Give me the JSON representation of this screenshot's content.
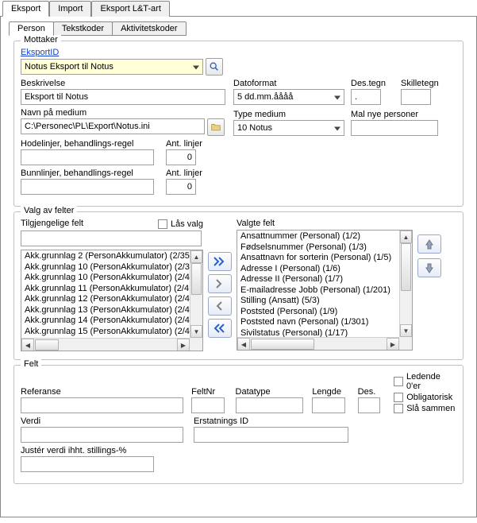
{
  "outer_tabs": {
    "t0": "Eksport",
    "t1": "Import",
    "t2": "Eksport L&T-art"
  },
  "inner_tabs": {
    "t0": "Person",
    "t1": "Tekstkoder",
    "t2": "Aktivitetskoder"
  },
  "mottaker": {
    "group": "Mottaker",
    "eksportid_label": "EksportID",
    "eksportid_value": "Notus Eksport til Notus",
    "beskrivelse_label": "Beskrivelse",
    "beskrivelse_value": "Eksport til Notus",
    "datoformat_label": "Datoformat",
    "datoformat_value": "5 dd.mm.åååå",
    "destegn_label": "Des.tegn",
    "destegn_value": ".",
    "skilletegn_label": "Skilletegn",
    "skilletegn_value": "",
    "navn_medium_label": "Navn på medium",
    "navn_medium_value": "C:\\Personec\\PL\\Export\\Notus.ini",
    "type_medium_label": "Type medium",
    "type_medium_value": "10 Notus",
    "mal_nye_label": "Mal nye personer",
    "mal_nye_value": "",
    "hodelinjer_label": "Hodelinjer, behandlings-regel",
    "hodelinjer_value": "",
    "ant_linjer": "Ant. linjer",
    "hodelinjer_ant": "0",
    "bunnlinjer_label": "Bunnlinjer, behandlings-regel",
    "bunnlinjer_value": "",
    "bunnlinjer_ant": "0"
  },
  "valg": {
    "group": "Valg av felter",
    "tilgjengelige_label": "Tilgjengelige felt",
    "las_valg": "Lås valg",
    "valgte_label": "Valgte felt",
    "filter_value": "",
    "available": {
      "i0": "Akk.grunnlag 2 (PersonAkkumulator) (2/35",
      "i1": "Akk.grunnlag 10 (PersonAkkumulator) (2/3",
      "i2": "Akk.grunnlag 10 (PersonAkkumulator) (2/4",
      "i3": "Akk.grunnlag 11 (PersonAkkumulator) (2/4",
      "i4": "Akk.grunnlag 12 (PersonAkkumulator) (2/4",
      "i5": "Akk.grunnlag 13 (PersonAkkumulator) (2/4",
      "i6": "Akk.grunnlag 14 (PersonAkkumulator) (2/4",
      "i7": "Akk.grunnlag 15 (PersonAkkumulator) (2/4"
    },
    "selected": {
      "i0": "Ansattnummer (Personal) (1/2)",
      "i1": "Fødselsnummer (Personal) (1/3)",
      "i2": "Ansattnavn for sorterin (Personal) (1/5)",
      "i3": "Adresse I (Personal) (1/6)",
      "i4": "Adresse II (Personal) (1/7)",
      "i5": "E-mailadresse Jobb (Personal) (1/201)",
      "i6": "Stilling (Ansatt) (5/3)",
      "i7": "Poststed (Personal) (1/9)",
      "i8": "Poststed navn (Personal) (1/301)",
      "i9": "Sivilstatus (Personal) (1/17)"
    }
  },
  "felt": {
    "group": "Felt",
    "referanse": "Referanse",
    "feltnr": "FeltNr",
    "datatype": "Datatype",
    "lengde": "Lengde",
    "des": "Des.",
    "ledende": "Ledende 0'er",
    "obligatorisk": "Obligatorisk",
    "sla_sammen": "Slå sammen",
    "verdi": "Verdi",
    "erstatnings": "Erstatnings ID",
    "juster": "Justér verdi ihht. stillings-%"
  }
}
